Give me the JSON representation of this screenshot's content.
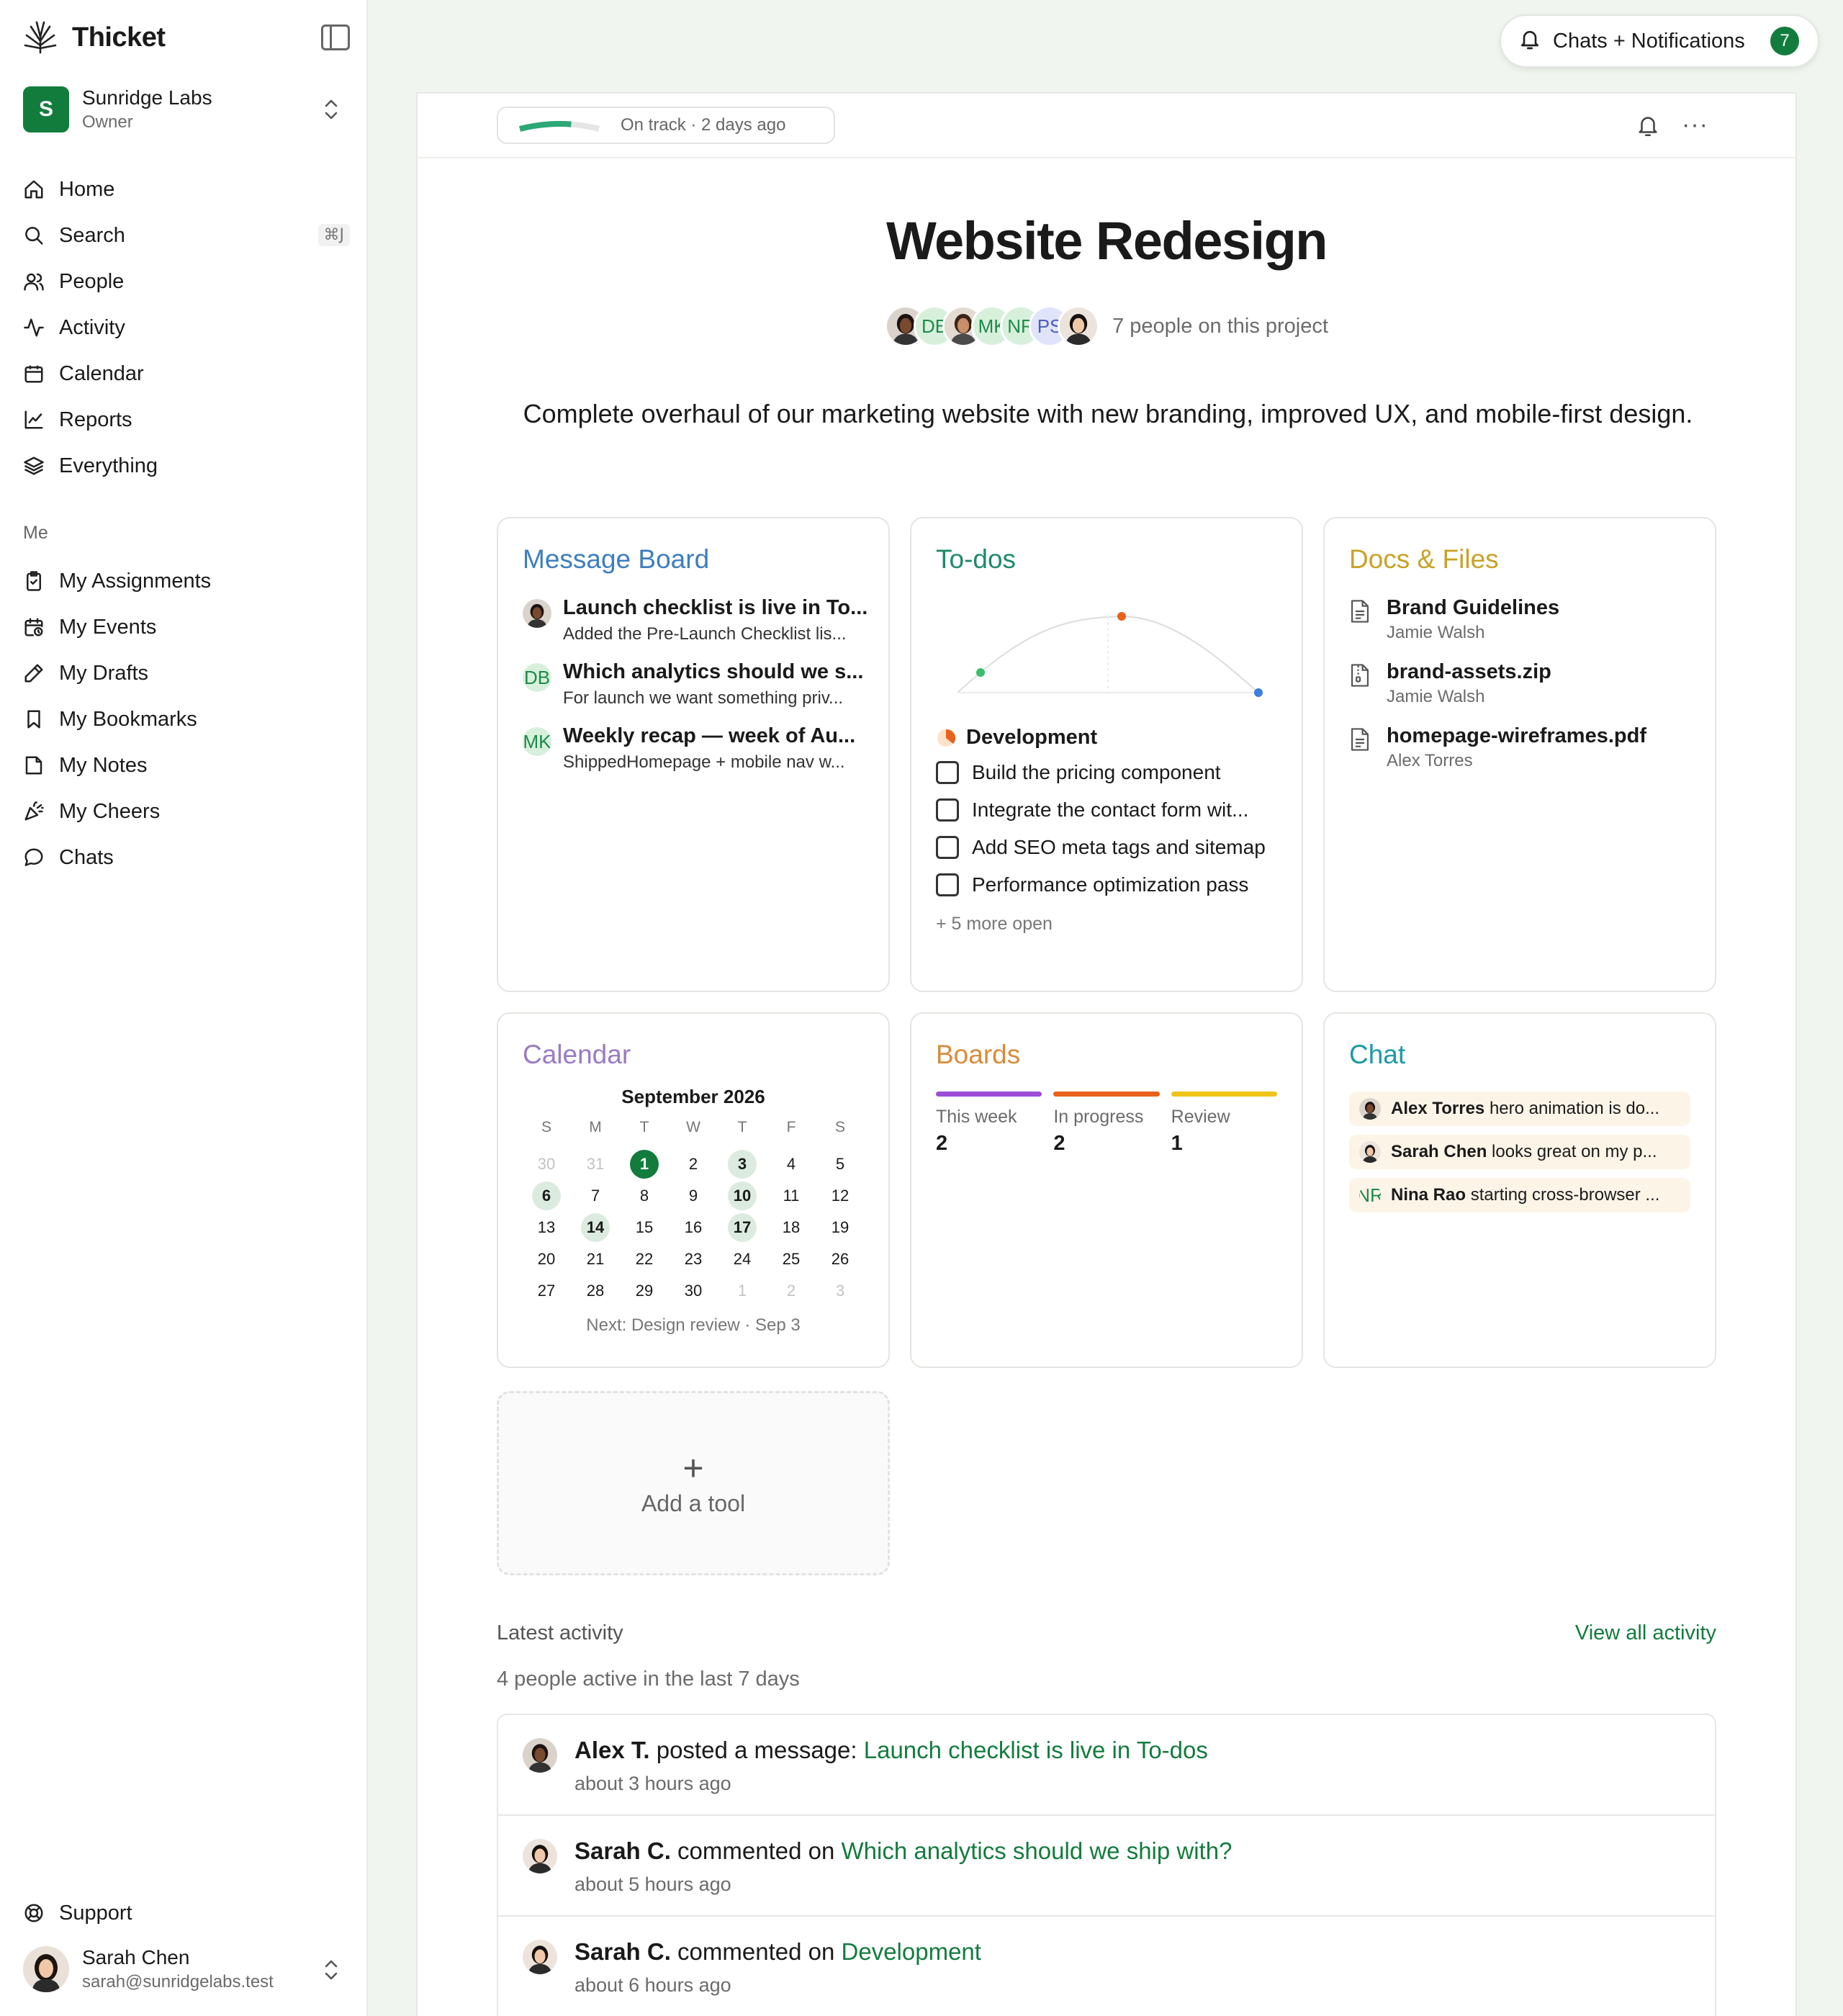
{
  "app": {
    "name": "Thicket"
  },
  "org": {
    "name": "Sunridge Labs",
    "role": "Owner",
    "initial": "S"
  },
  "nav": {
    "home": "Home",
    "search": "Search",
    "search_shortcut": "⌘J",
    "people": "People",
    "activity": "Activity",
    "calendar": "Calendar",
    "reports": "Reports",
    "everything": "Everything"
  },
  "me_section": {
    "label": "Me",
    "items": [
      "My Assignments",
      "My Events",
      "My Drafts",
      "My Bookmarks",
      "My Notes",
      "My Cheers",
      "Chats"
    ]
  },
  "support": "Support",
  "user": {
    "name": "Sarah Chen",
    "email": "sarah@sunridgelabs.test"
  },
  "notifications": {
    "label": "Chats + Notifications",
    "count": "7"
  },
  "project": {
    "status": "On track · 2 days ago",
    "status_progress": 0.6,
    "title": "Website Redesign",
    "people_text": "7 people on this project",
    "avatars": [
      "",
      "DB",
      "",
      "MK",
      "NR",
      "PS",
      ""
    ],
    "description": "Complete overhaul of our marketing website with new branding, improved UX, and mobile-first design."
  },
  "tools": {
    "message_board": {
      "title": "Message Board",
      "items": [
        {
          "avatar": "",
          "title": "Launch checklist is live in To...",
          "sub": "Added the Pre-Launch Checklist lis..."
        },
        {
          "avatar": "DB",
          "title": "Which analytics should we s...",
          "sub": "For launch we want something priv..."
        },
        {
          "avatar": "MK",
          "title": "Weekly recap — week of Au...",
          "sub": "ShippedHomepage + mobile nav w..."
        }
      ]
    },
    "todos": {
      "title": "To-dos",
      "group": "Development",
      "items": [
        "Build the pricing component",
        "Integrate the contact form wit...",
        "Add SEO meta tags and sitemap",
        "Performance optimization pass"
      ],
      "more": "+ 5 more open"
    },
    "docs": {
      "title": "Docs & Files",
      "items": [
        {
          "name": "Brand Guidelines",
          "author": "Jamie Walsh",
          "icon": "document-icon"
        },
        {
          "name": "brand-assets.zip",
          "author": "Jamie Walsh",
          "icon": "zip-file-icon"
        },
        {
          "name": "homepage-wireframes.pdf",
          "author": "Alex Torres",
          "icon": "document-icon"
        }
      ]
    },
    "calendar": {
      "title": "Calendar",
      "month": "September 2026",
      "dow": [
        "S",
        "M",
        "T",
        "W",
        "T",
        "F",
        "S"
      ],
      "weeks": [
        [
          {
            "d": "30",
            "m": true
          },
          {
            "d": "31",
            "m": true
          },
          {
            "d": "1",
            "t": true
          },
          {
            "d": "2"
          },
          {
            "d": "3",
            "e": true
          },
          {
            "d": "4"
          },
          {
            "d": "5"
          }
        ],
        [
          {
            "d": "6",
            "e": true
          },
          {
            "d": "7"
          },
          {
            "d": "8"
          },
          {
            "d": "9"
          },
          {
            "d": "10",
            "e": true
          },
          {
            "d": "11"
          },
          {
            "d": "12"
          }
        ],
        [
          {
            "d": "13"
          },
          {
            "d": "14",
            "e": true
          },
          {
            "d": "15"
          },
          {
            "d": "16"
          },
          {
            "d": "17",
            "e": true
          },
          {
            "d": "18"
          },
          {
            "d": "19"
          }
        ],
        [
          {
            "d": "20"
          },
          {
            "d": "21"
          },
          {
            "d": "22"
          },
          {
            "d": "23"
          },
          {
            "d": "24"
          },
          {
            "d": "25"
          },
          {
            "d": "26"
          }
        ],
        [
          {
            "d": "27"
          },
          {
            "d": "28"
          },
          {
            "d": "29"
          },
          {
            "d": "30"
          },
          {
            "d": "1",
            "m": true
          },
          {
            "d": "2",
            "m": true
          },
          {
            "d": "3",
            "m": true
          }
        ]
      ],
      "next": "Next: Design review · Sep 3"
    },
    "boards": {
      "title": "Boards",
      "columns": [
        {
          "name": "This week",
          "count": "2",
          "color": "#9b4dd6"
        },
        {
          "name": "In progress",
          "count": "2",
          "color": "#e8621c"
        },
        {
          "name": "Review",
          "count": "1",
          "color": "#f0c419"
        }
      ]
    },
    "chat": {
      "title": "Chat",
      "items": [
        {
          "avatar": "",
          "author": "Alex Torres",
          "text": "hero animation is do..."
        },
        {
          "avatar": "",
          "author": "Sarah Chen",
          "text": "looks great on my p..."
        },
        {
          "avatar": "NR",
          "author": "Nina Rao",
          "text": "starting cross-browser ..."
        }
      ]
    },
    "add_tool": {
      "label": "Add a tool"
    }
  },
  "activity": {
    "heading": "Latest activity",
    "view_all": "View all activity",
    "summary": "4 people active in the last 7 days",
    "items": [
      {
        "name": "Alex T.",
        "action": " posted a message: ",
        "target": "Launch checklist is live in To-dos",
        "time": "about 3 hours ago"
      },
      {
        "name": "Sarah C.",
        "action": " commented on ",
        "target": "Which analytics should we ship with?",
        "time": "about 5 hours ago"
      },
      {
        "name": "Sarah C.",
        "action": " commented on ",
        "target": "Development",
        "time": "about 6 hours ago"
      }
    ]
  },
  "colors": {
    "brand": "#127c3d",
    "message_board": "#3d7ebf",
    "todos": "#1f8a6a",
    "docs": "#c9a227",
    "calendar": "#9a7ac4",
    "boards": "#d98b3a",
    "chat": "#1c9aa8"
  }
}
